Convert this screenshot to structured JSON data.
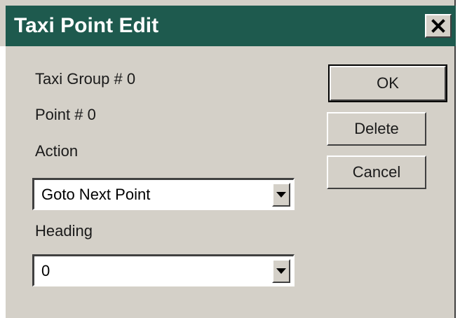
{
  "window": {
    "title": "Taxi Point Edit",
    "close_glyph": "✕"
  },
  "info": {
    "taxi_group": "Taxi Group # 0",
    "point": "Point # 0"
  },
  "action": {
    "label": "Action",
    "selected": "Goto Next Point"
  },
  "heading": {
    "label": "Heading",
    "selected": "0"
  },
  "buttons": {
    "ok": "OK",
    "delete": "Delete",
    "cancel": "Cancel"
  },
  "icons": {
    "close": "close-icon",
    "dropdown": "chevron-down-icon"
  },
  "colors": {
    "titlebar": "#1e5a4e",
    "dialog": "#d4d0c8"
  }
}
